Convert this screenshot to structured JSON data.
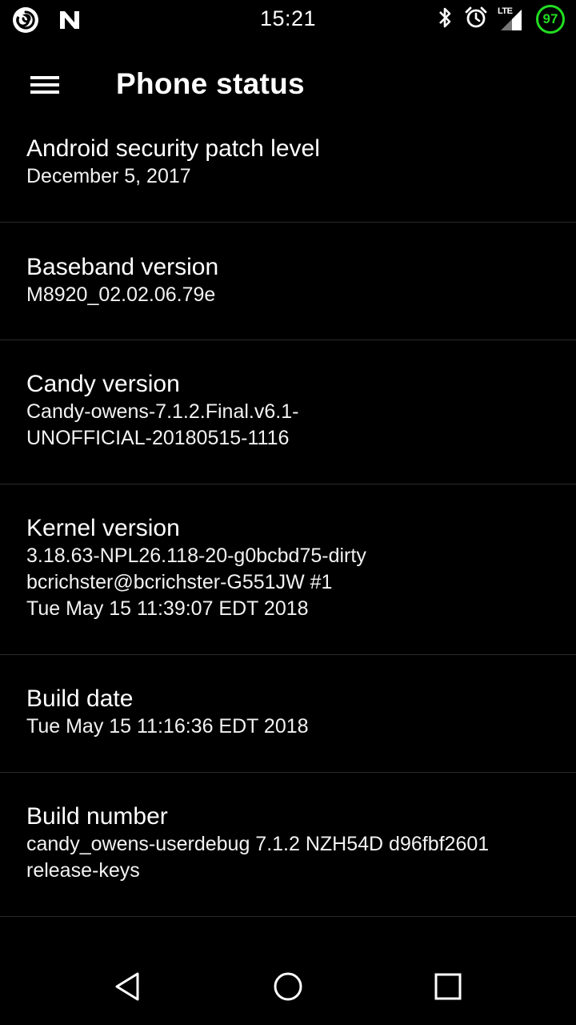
{
  "status_bar": {
    "time": "15:21",
    "network_type": "LTE",
    "battery_level": "97",
    "battery_color": "#22dd22",
    "left_icons": [
      "candy-rom-icon",
      "notification-n-icon"
    ],
    "right_icons": [
      "bluetooth-icon",
      "alarm-clock-icon",
      "signal-icon",
      "battery-icon"
    ]
  },
  "app_bar": {
    "menu_icon": "hamburger-menu-icon",
    "title": "Phone status"
  },
  "items": [
    {
      "title": "Android security patch level",
      "summary": "December 5, 2017"
    },
    {
      "title": "Baseband version",
      "summary": "M8920_02.02.06.79e"
    },
    {
      "title": "Candy version",
      "summary": "Candy-owens-7.1.2.Final.v6.1-\nUNOFFICIAL-20180515-1116"
    },
    {
      "title": "Kernel version",
      "summary": "3.18.63-NPL26.118-20-g0bcbd75-dirty\nbcrichster@bcrichster-G551JW #1\nTue May 15 11:39:07 EDT 2018"
    },
    {
      "title": "Build date",
      "summary": "Tue May 15 11:16:36 EDT 2018"
    },
    {
      "title": "Build number",
      "summary": "candy_owens-userdebug 7.1.2 NZH54D d96fbf2601\nrelease-keys"
    }
  ],
  "nav_bar": {
    "icons": [
      "back-icon",
      "home-icon",
      "recents-icon"
    ]
  }
}
